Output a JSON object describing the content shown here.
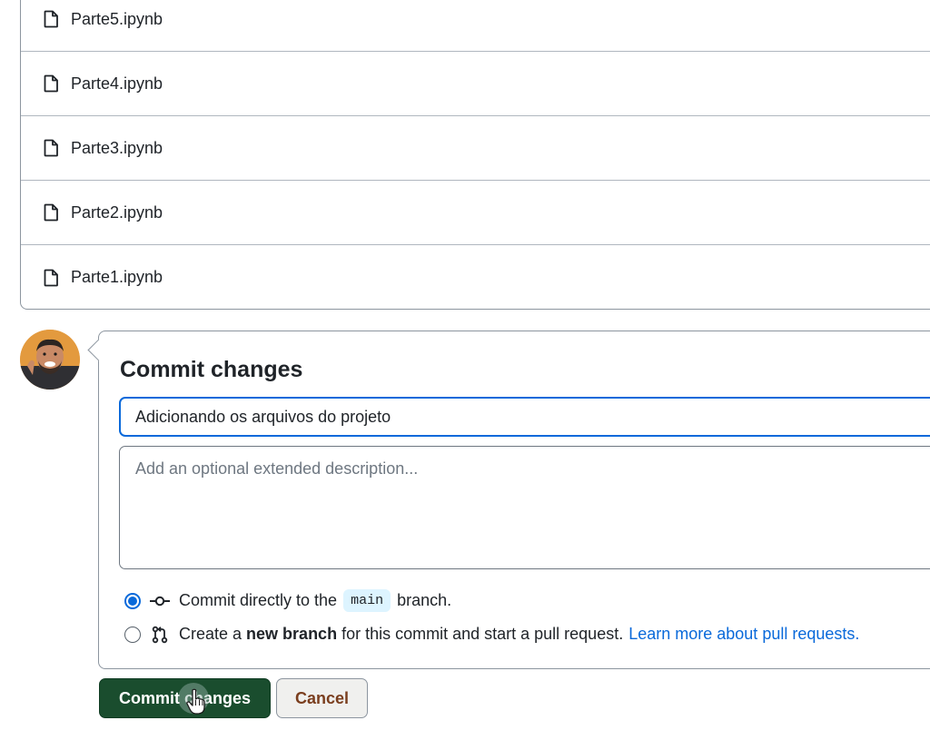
{
  "files": [
    {
      "name": "Parte5.ipynb",
      "icon": "file-icon"
    },
    {
      "name": "Parte4.ipynb",
      "icon": "file-icon"
    },
    {
      "name": "Parte3.ipynb",
      "icon": "file-icon"
    },
    {
      "name": "Parte2.ipynb",
      "icon": "file-icon"
    },
    {
      "name": "Parte1.ipynb",
      "icon": "file-icon"
    }
  ],
  "commit": {
    "title": "Commit changes",
    "summary_value": "Adicionando os arquivos do projeto",
    "description_placeholder": "Add an optional extended description...",
    "option_direct": {
      "prefix": "Commit directly to the",
      "branch": "main",
      "suffix": "branch.",
      "selected": true
    },
    "option_new_branch": {
      "prefix": "Create a",
      "bold": "new branch",
      "suffix": "for this commit and start a pull request.",
      "link": "Learn more about pull requests.",
      "selected": false
    }
  },
  "buttons": {
    "commit_label": "Commit changes",
    "cancel_label": "Cancel"
  },
  "colors": {
    "accent": "#0969da",
    "commit_button_bg": "#1a4d2e",
    "cancel_text": "#7a3e1e"
  }
}
